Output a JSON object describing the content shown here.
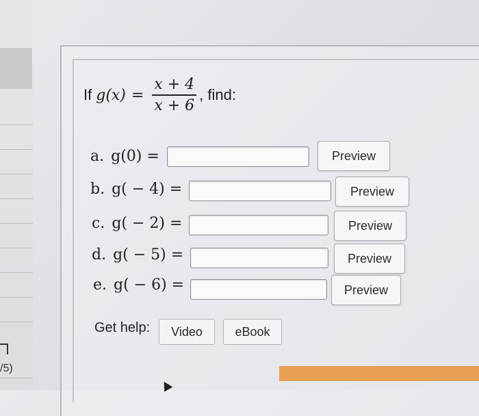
{
  "question": {
    "prefix": "If",
    "func_lhs": "g(x)",
    "equals": "=",
    "numerator": "x + 4",
    "denominator": "x + 6",
    "suffix": ", find:"
  },
  "parts": [
    {
      "letter": "a.",
      "expr": "g(0) ="
    },
    {
      "letter": "b.",
      "expr": "g( − 4) ="
    },
    {
      "letter": "c.",
      "expr": "g( − 2) ="
    },
    {
      "letter": "d.",
      "expr": "g( − 5) ="
    },
    {
      "letter": "e.",
      "expr": "g( − 6) ="
    }
  ],
  "answers": [
    "",
    "",
    "",
    "",
    ""
  ],
  "preview_label": "Preview",
  "help": {
    "label": "Get help:",
    "video": "Video",
    "ebook": "eBook"
  },
  "sidebar": {
    "fragment_text": "/5)"
  },
  "colors": {
    "progress_bar": "#e8a154"
  }
}
